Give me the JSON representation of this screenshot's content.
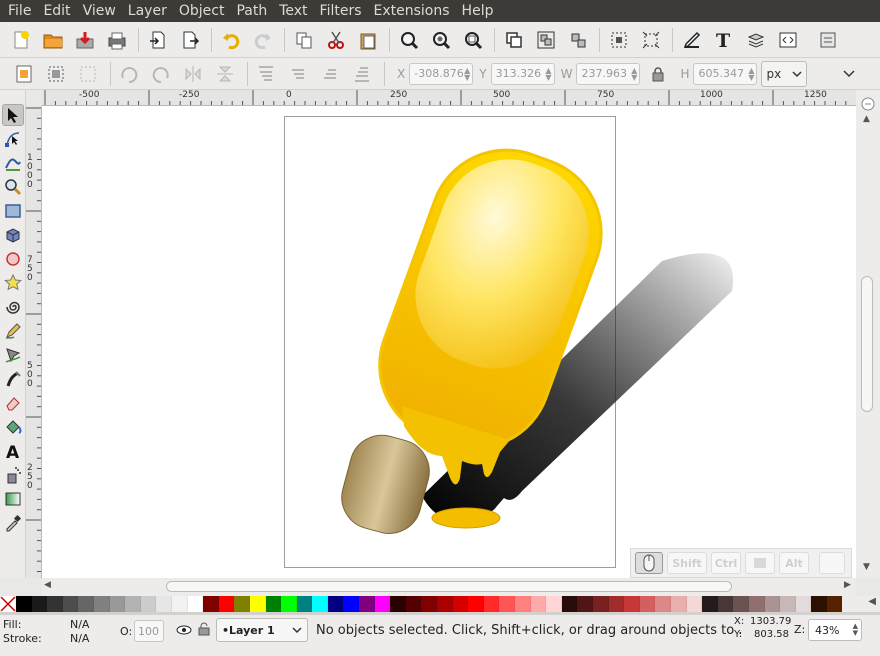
{
  "menu": [
    "File",
    "Edit",
    "View",
    "Layer",
    "Object",
    "Path",
    "Text",
    "Filters",
    "Extensions",
    "Help"
  ],
  "toolcontrols": {
    "x_label": "X",
    "x_value": "-308.876",
    "y_label": "Y",
    "y_value": "313.326",
    "w_label": "W",
    "w_value": "237.963",
    "h_label": "H",
    "h_value": "605.347",
    "unit": "px"
  },
  "rulers": {
    "horizontal": [
      "-500",
      "-250",
      "0",
      "250",
      "500",
      "750",
      "1000",
      "1250"
    ],
    "vertical": [
      "1000",
      "750",
      "500",
      "250"
    ]
  },
  "keys": [
    "Shift",
    "Ctrl",
    "",
    "Alt",
    ""
  ],
  "palette": [
    "#000000",
    "#1a1a1a",
    "#333333",
    "#4d4d4d",
    "#666666",
    "#808080",
    "#999999",
    "#b3b3b3",
    "#cccccc",
    "#e6e6e6",
    "#f2f2f2",
    "#ffffff",
    "#800000",
    "#ff0000",
    "#808000",
    "#ffff00",
    "#008000",
    "#00ff00",
    "#008080",
    "#00ffff",
    "#000080",
    "#0000ff",
    "#800080",
    "#ff00ff",
    "#2b0000",
    "#550000",
    "#800000",
    "#aa0000",
    "#d40000",
    "#ff0000",
    "#ff2a2a",
    "#ff5555",
    "#ff8080",
    "#ffaaaa",
    "#ffd5d5",
    "#280b0b",
    "#501616",
    "#782121",
    "#a02c2c",
    "#c83737",
    "#d35f5f",
    "#de8787",
    "#e9afaf",
    "#f4d7d7",
    "#241c1c",
    "#483737",
    "#6c5353",
    "#916f6f",
    "#ac9393",
    "#c8b7b7",
    "#e3dbdb",
    "#2b1100",
    "#552200"
  ],
  "status": {
    "fill_label": "Fill:",
    "fill_value": "N/A",
    "stroke_label": "Stroke:",
    "stroke_value": "N/A",
    "opacity_label": "O:",
    "opacity_value": "100",
    "layer": "•Layer 1",
    "message": "No objects selected. Click, Shift+click, or drag around objects to .",
    "x_label": "X:",
    "x_coord": "1303.79",
    "y_label": "Y:",
    "y_coord": "803.58",
    "zoom_label": "Z:",
    "zoom": "43%"
  }
}
